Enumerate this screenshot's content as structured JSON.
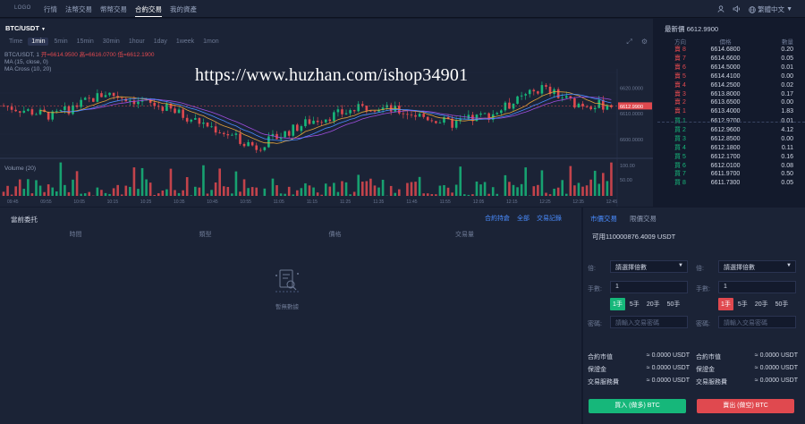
{
  "topbar": {
    "logo": "LOGO",
    "nav": [
      "行情",
      "法幣交易",
      "幣幣交易",
      "合約交易",
      "我的資產"
    ],
    "active_nav": 3,
    "language": "繁體中文"
  },
  "chart_header": {
    "symbol": "BTC/USDT",
    "intervals": [
      "Time",
      "1min",
      "5min",
      "15min",
      "30min",
      "1hour",
      "1day",
      "1week",
      "1mon"
    ],
    "active_interval": 1
  },
  "chart_legend": {
    "line1_prefix": "BTC/USDT, 1",
    "open": "开=6614.9500",
    "high": "高=6616.0700",
    "low": "低=6612.1900",
    "line2": "MA (15, close, 0)",
    "line3": "MA Cross (10, 20)",
    "volume": "Volume (20)"
  },
  "watermark": "https://www.huzhan.com/ishop34901",
  "chart_data": {
    "type": "candlestick",
    "price_axis_labels": [
      "6620.0000",
      "6610.0000",
      "6600.0000"
    ],
    "current_price_tag": "6612.9900",
    "volume_axis_labels": [
      "100.00",
      "50.00"
    ],
    "x_labels": [
      "09:45",
      "09:55",
      "10:05",
      "10:15",
      "10:25",
      "10:35",
      "10:45",
      "10:55",
      "11:05",
      "11:15",
      "11:25",
      "11:35",
      "11:45",
      "11:55",
      "12:05",
      "12:15",
      "12:25",
      "12:35",
      "12:45"
    ],
    "ylim": [
      6594,
      6626
    ],
    "colors": {
      "up": "#16b77a",
      "down": "#e0494f",
      "ma_fast": "#e3a33a",
      "ma_slow": "#a04ee0",
      "ma_close": "#4a8cff"
    }
  },
  "orderbook": {
    "last_label": "最新價",
    "last_price": "6612.9900",
    "headers": [
      "方向",
      "價格",
      "數量"
    ],
    "asks": [
      {
        "label": "賣 8",
        "price": "6614.6800",
        "qty": "0.20"
      },
      {
        "label": "賣 7",
        "price": "6614.6600",
        "qty": "0.05"
      },
      {
        "label": "賣 6",
        "price": "6614.5000",
        "qty": "0.01"
      },
      {
        "label": "賣 5",
        "price": "6614.4100",
        "qty": "0.00"
      },
      {
        "label": "賣 4",
        "price": "6614.2500",
        "qty": "0.02"
      },
      {
        "label": "賣 3",
        "price": "6613.8000",
        "qty": "0.17"
      },
      {
        "label": "賣 2",
        "price": "6613.6500",
        "qty": "0.00"
      },
      {
        "label": "賣 1",
        "price": "6613.4000",
        "qty": "1.83"
      }
    ],
    "bids": [
      {
        "label": "買 1",
        "price": "6612.9700",
        "qty": "0.01"
      },
      {
        "label": "買 2",
        "price": "6612.9600",
        "qty": "4.12"
      },
      {
        "label": "買 3",
        "price": "6612.8500",
        "qty": "0.00"
      },
      {
        "label": "買 4",
        "price": "6612.1800",
        "qty": "0.11"
      },
      {
        "label": "買 5",
        "price": "6612.1700",
        "qty": "0.16"
      },
      {
        "label": "買 6",
        "price": "6612.0100",
        "qty": "0.08"
      },
      {
        "label": "買 7",
        "price": "6611.9700",
        "qty": "0.50"
      },
      {
        "label": "買 8",
        "price": "6611.7300",
        "qty": "0.05"
      }
    ]
  },
  "orders": {
    "title": "當前委托",
    "links": [
      "合約持倉",
      "全部",
      "交易記錄"
    ],
    "headers": [
      "時間",
      "類型",
      "價格",
      "交易量"
    ],
    "empty_text": "暫無數據"
  },
  "trade": {
    "tabs": [
      "市價交易",
      "限價交易"
    ],
    "available": "可用110000876.4009 USDT",
    "buy": {
      "leverage_label": "倍:",
      "leverage_value": "請選擇倍數",
      "lots_label": "手數:",
      "lots_value": "1",
      "lot_options": [
        "1手",
        "5手",
        "20手",
        "50手"
      ],
      "code_label": "密碼:",
      "code_placeholder": "請輸入交易密碼",
      "stats": [
        {
          "label": "合約市值",
          "value": "≈ 0.0000 USDT"
        },
        {
          "label": "保證金",
          "value": "≈ 0.0000 USDT"
        },
        {
          "label": "交易服務費",
          "value": "≈ 0.0000 USDT"
        }
      ],
      "button": "買入 (做多) BTC"
    },
    "sell": {
      "leverage_label": "倍:",
      "leverage_value": "請選擇倍數",
      "lots_label": "手數:",
      "lots_value": "1",
      "lot_options": [
        "1手",
        "5手",
        "20手",
        "50手"
      ],
      "code_label": "密碼:",
      "code_placeholder": "請輸入交易密碼",
      "stats": [
        {
          "label": "合約市值",
          "value": "≈ 0.0000 USDT"
        },
        {
          "label": "保證金",
          "value": "≈ 0.0000 USDT"
        },
        {
          "label": "交易服務費",
          "value": "≈ 0.0000 USDT"
        }
      ],
      "button": "賣出 (做空) BTC"
    }
  }
}
